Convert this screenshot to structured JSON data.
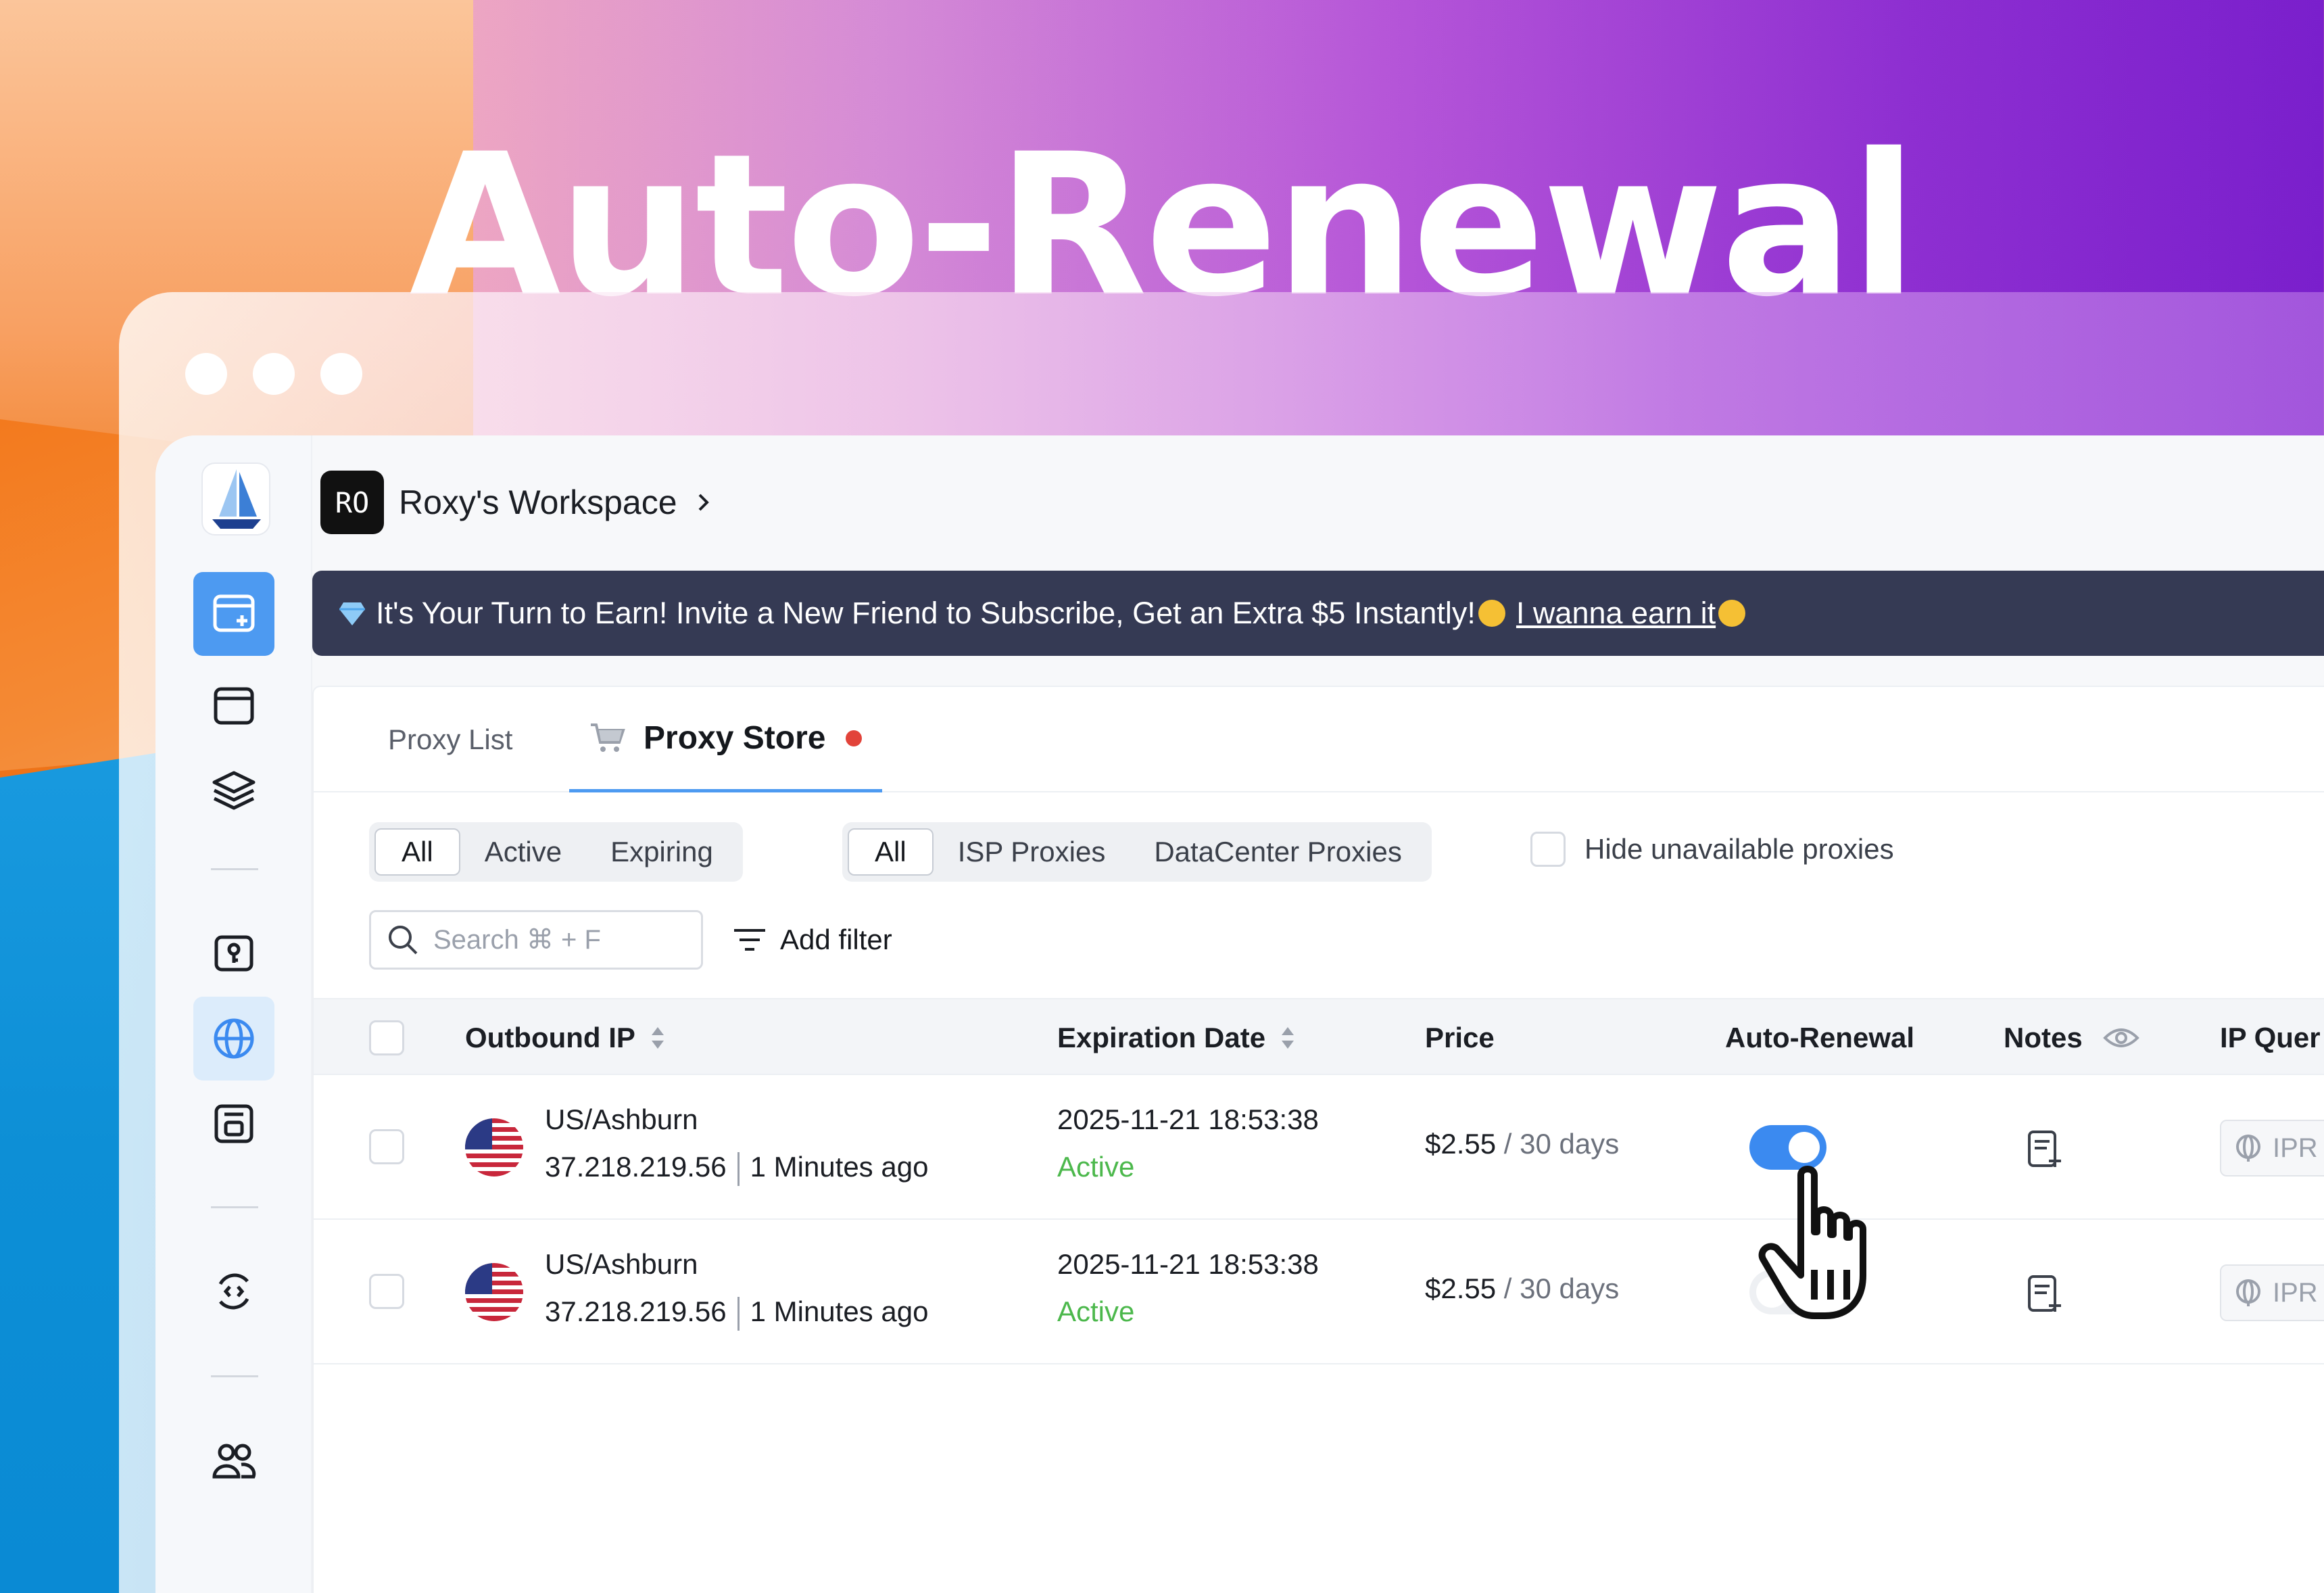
{
  "headline": "Auto-Renewal",
  "workspace": {
    "badge": "RO",
    "name": "Roxy's Workspace"
  },
  "banner": {
    "message": "It's Your Turn to Earn! Invite a New Friend to Subscribe, Get an Extra $5 Instantly!",
    "link": "I wanna earn it"
  },
  "tabs": [
    {
      "label": "Proxy List",
      "active": false
    },
    {
      "label": "Proxy Store",
      "active": true
    }
  ],
  "status_filter": {
    "items": [
      "All",
      "Active",
      "Expiring"
    ],
    "selected": "All"
  },
  "type_filter": {
    "items": [
      "All",
      "ISP Proxies",
      "DataCenter Proxies"
    ],
    "selected": "All"
  },
  "hide_unavailable": {
    "label": "Hide unavailable proxies",
    "checked": false
  },
  "search": {
    "placeholder": "Search ⌘ + F"
  },
  "add_filter": "Add filter",
  "table": {
    "columns": [
      "Outbound IP",
      "Expiration Date",
      "Price",
      "Auto-Renewal",
      "Notes",
      "IP Quer"
    ],
    "rows": [
      {
        "location": "US/Ashburn",
        "ip": "37.218.219.56",
        "checked": "1 Minutes ago",
        "expiration": "2025-11-21 18:53:38",
        "status": "Active",
        "price": "$2.55",
        "period": "/ 30 days",
        "auto_renewal": true,
        "ip_query": "IPR"
      },
      {
        "location": "US/Ashburn",
        "ip": "37.218.219.56",
        "checked": "1 Minutes ago",
        "expiration": "2025-11-21 18:53:38",
        "status": "Active",
        "price": "$2.55",
        "period": "/ 30 days",
        "auto_renewal": false,
        "ip_query": "IPR"
      }
    ]
  },
  "colors": {
    "accent": "#4d9af1",
    "toggle_on": "#3b8af0",
    "active_status": "#4cb84c",
    "banner_bg": "#353a54"
  },
  "icons": [
    "add-profile-icon",
    "browser-icon",
    "layers-icon",
    "key-icon",
    "globe-icon",
    "save-icon",
    "sync-icon",
    "users-icon",
    "cart-icon",
    "search-icon",
    "filter-icon",
    "eye-icon",
    "note-add-icon",
    "hand-cursor-icon"
  ]
}
